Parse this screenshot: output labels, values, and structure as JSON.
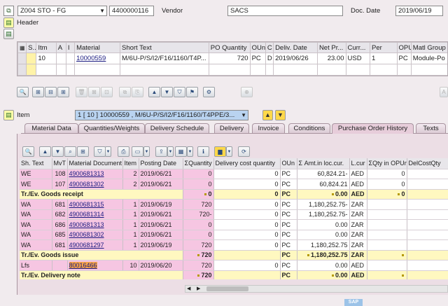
{
  "header_line": {
    "doc_type": "Z004 STO - FG",
    "po_number": "4400000116",
    "vendor_label": "Vendor",
    "vendor_value": "SACS",
    "doc_date_label": "Doc. Date",
    "doc_date_value": "2019/06/19"
  },
  "header_section": {
    "label": "Header"
  },
  "item_grid": {
    "columns": [
      "S..",
      "Itm",
      "A",
      "I",
      "Material",
      "Short Text",
      "PO Quantity",
      "OUn",
      "C",
      "Deliv. Date",
      "Net Pr...",
      "Curr...",
      "Per",
      "OPU",
      "Matl Group"
    ],
    "row": {
      "itm": "10",
      "a": "",
      "i": "",
      "material": "10000559",
      "short_text": "M/6U-P/S/I2/F16/1160/T4P...",
      "po_qty": "720",
      "oun": "PC",
      "c": "D",
      "deliv_date": "2019/06/26",
      "net_price": "23.00",
      "curr": "USD",
      "per": "1",
      "opu": "PC",
      "matl_group": "Module-Po"
    }
  },
  "item_section": {
    "label": "Item",
    "selector": "1 [ 10 ] 10000559 , M/6U-P/S/I2/F16/1160/T4PPE/3..."
  },
  "tabs": [
    "Material Data",
    "Quantities/Weights",
    "Delivery Schedule",
    "Delivery",
    "Invoice",
    "Conditions",
    "Purchase Order History",
    "Texts"
  ],
  "active_tab": "Purchase Order History",
  "history": {
    "columns": [
      "Sh. Text",
      "MvT",
      "Material Document",
      "Item",
      "Posting Date",
      "Quantity",
      "Delivery cost quantity",
      "OUn",
      "Amt.in loc.cur.",
      "L.cur",
      "Qty in OPUn",
      "DelCostQty"
    ],
    "rows": [
      {
        "type": "line",
        "sh": "WE",
        "mvt": "108",
        "doc": "4900681313",
        "item": "2",
        "date": "2019/06/21",
        "qty": "0",
        "dcq": "0",
        "oun": "PC",
        "amt": "60,824.21-",
        "cur": "AED",
        "qopu": "0",
        "dcqty": ""
      },
      {
        "type": "line",
        "sh": "WE",
        "mvt": "107",
        "doc": "4900681302",
        "item": "2",
        "date": "2019/06/21",
        "qty": "0",
        "dcq": "0",
        "oun": "PC",
        "amt": "60,824.21",
        "cur": "AED",
        "qopu": "0",
        "dcqty": ""
      },
      {
        "type": "total",
        "label": "Tr./Ev. Goods receipt",
        "qty": "0",
        "dcq": "0",
        "oun": "PC",
        "amt": "0.00",
        "cur": "AED",
        "qopu": "0"
      },
      {
        "type": "line",
        "sh": "WA",
        "mvt": "681",
        "doc": "4900681315",
        "item": "1",
        "date": "2019/06/19",
        "qty": "720",
        "dcq": "0",
        "oun": "PC",
        "amt": "1,180,252.75-",
        "cur": "ZAR",
        "qopu": "",
        "dcqty": ""
      },
      {
        "type": "line",
        "sh": "WA",
        "mvt": "682",
        "doc": "4900681314",
        "item": "1",
        "date": "2019/06/21",
        "qty": "720-",
        "dcq": "0",
        "oun": "PC",
        "amt": "1,180,252.75-",
        "cur": "ZAR",
        "qopu": "",
        "dcqty": ""
      },
      {
        "type": "line",
        "sh": "WA",
        "mvt": "686",
        "doc": "4900681313",
        "item": "1",
        "date": "2019/06/21",
        "qty": "0",
        "dcq": "0",
        "oun": "PC",
        "amt": "0.00",
        "cur": "ZAR",
        "qopu": "",
        "dcqty": ""
      },
      {
        "type": "line",
        "sh": "WA",
        "mvt": "685",
        "doc": "4900681302",
        "item": "1",
        "date": "2019/06/21",
        "qty": "0",
        "dcq": "0",
        "oun": "PC",
        "amt": "0.00",
        "cur": "ZAR",
        "qopu": "",
        "dcqty": ""
      },
      {
        "type": "line",
        "sh": "WA",
        "mvt": "681",
        "doc": "4900681297",
        "item": "1",
        "date": "2019/06/19",
        "qty": "720",
        "dcq": "0",
        "oun": "PC",
        "amt": "1,180,252.75",
        "cur": "ZAR",
        "qopu": "",
        "dcqty": ""
      },
      {
        "type": "total",
        "label": "Tr./Ev. Goods issue",
        "qty": "720",
        "dcq": "",
        "oun": "PC",
        "amt": "1,180,252.75",
        "cur": "ZAR",
        "qopu": ""
      },
      {
        "type": "line",
        "sh": "Lfs",
        "mvt": "",
        "doc": "80016466",
        "item": "10",
        "date": "2019/06/20",
        "qty": "720",
        "dcq": "0",
        "oun": "PC",
        "amt": "0.00",
        "cur": "AED",
        "qopu": "",
        "dcqty": ""
      },
      {
        "type": "total",
        "label": "Tr./Ev. Delivery note",
        "qty": "720",
        "dcq": "",
        "oun": "PC",
        "amt": "0.00",
        "cur": "AED",
        "qopu": ""
      }
    ]
  },
  "colors": {
    "pink": "#f6c6e2",
    "total_yellow": "#fff8c0",
    "selector_blue": "#b9d3f0",
    "tab_active": "#e7cdda"
  }
}
